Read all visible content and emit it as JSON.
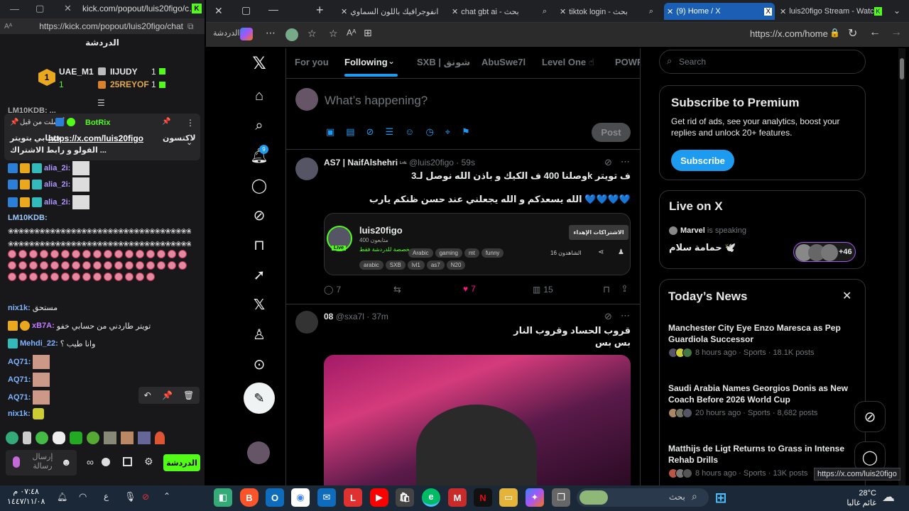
{
  "colors": {
    "kick_green": "#53fc18",
    "x_blue": "#1d9bf0",
    "accent_pink": "#f91880"
  },
  "kick_window": {
    "url_top": "kick.com/popout/luis20figo/c…",
    "url": "https://kick.com/popout/luis20figo/chat",
    "chat_title": "الدردشة",
    "leaderboard": [
      {
        "name": "UAE_M1",
        "count": "1",
        "rank": "1"
      },
      {
        "name": "IIJUDY",
        "count": "1"
      },
      {
        "name": "25REYOF",
        "count": "1"
      }
    ],
    "partial_name": "LM10KDB: ...",
    "pinned": {
      "header": "أرسلت من قبل",
      "user": "BotRix",
      "text1": "لاكتسون",
      "link": "https://x.com/luis20figo",
      "text2": "حسابي بتويتر",
      "text3": "الفولو و رابط الاشتراك ..."
    },
    "messages": [
      {
        "user": "alia_2i:",
        "type": "img"
      },
      {
        "user": "alia_2i:",
        "type": "img"
      },
      {
        "user": "alia_2i:",
        "type": "img"
      },
      {
        "user": "LM10KDB:",
        "type": "text",
        "text": ""
      },
      {
        "user": "nix1k:",
        "type": "text",
        "text": "مستحق"
      },
      {
        "user": "xB7A:",
        "type": "text",
        "text": "تويتر طاردني من حسابي خفو"
      },
      {
        "user": "Mehdi_22:",
        "type": "text",
        "text": "وانا طيب ؟"
      },
      {
        "user": "AQ71:",
        "type": "img"
      },
      {
        "user": "AQ71:",
        "type": "img"
      },
      {
        "user": "AQ71:",
        "type": "img"
      },
      {
        "user": "nix1k:",
        "type": "img"
      }
    ],
    "send_placeholder": "إرسال رسالة",
    "chat_button": "الدردشة"
  },
  "edge": {
    "tabs": [
      {
        "label": "انفوجرافيك باللون السماوي"
      },
      {
        "label": "chat gbt ai - بحث"
      },
      {
        "label": "tiktok login - بحث"
      },
      {
        "label": "(9) Home / X"
      },
      {
        "label": "luis20figo Stream - Watc"
      }
    ],
    "address": "https://x.com/home",
    "sidebar_label": "الدردشة",
    "status_url": "https://x.com/luis20figo"
  },
  "x": {
    "notif_badge": "9",
    "feed_tabs": [
      "For you",
      "Following",
      "SXB | شونق",
      "AbuSwe7l",
      "Level One ☝",
      "POWR"
    ],
    "compose_placeholder": "What’s happening?",
    "post_button": "Post",
    "posts": [
      {
        "name": "AS7 | NaifAlshehri",
        "badge": "ᴸᵛˡ¹",
        "handle": "@luis20figo",
        "time": "59s",
        "line1": "وصلنا 400 ف الكيك و باذن الله نوصل لـ3k ف تويتر",
        "line2": "الله يسعدكم و الله يجعلني عند حسن ظنكم يارب 💙💙💙💙",
        "embed": {
          "title": "luis20figo",
          "followers": "400 متابعون",
          "live": "Live",
          "sub_label": "مخصصة للدردشة فقط",
          "tags": [
            "Arabic",
            "gaming",
            "mt",
            "funny",
            "arabic",
            "SXB",
            "lvl1",
            "as7",
            "N20"
          ],
          "sub_button": "الاشتراكات الإهداء",
          "viewers": "الشاهدون 16"
        },
        "stats": {
          "replies": "7",
          "reposts": "",
          "likes": "7",
          "views": "15"
        }
      },
      {
        "name": "08",
        "handle": "@sxa7l",
        "time": "37m",
        "line1": "قروب الحساد وقروب النار",
        "line2": "بس بس"
      }
    ],
    "search_placeholder": "Search",
    "premium": {
      "title": "Subscribe to Premium",
      "desc": "Get rid of ads, see your analytics, boost your replies and unlock 20+ features.",
      "button": "Subscribe"
    },
    "live": {
      "title": "Live on X",
      "host": "Marvel",
      "speaking": "is speaking",
      "space": "حمامة سلام 🕊️",
      "count": "+46"
    },
    "news": {
      "title": "Today’s News",
      "items": [
        {
          "headline": "Manchester City Eye Enzo Maresca as Pep Guardiola Successor",
          "meta": "8 hours ago · Sports · 18.1K posts"
        },
        {
          "headline": "Saudi Arabia Names Georgios Donis as New Coach Before 2026 World Cup",
          "meta": "20 hours ago · Sports · 8,682 posts"
        },
        {
          "headline": "Matthijs de Ligt Returns to Grass in Intense Rehab Drills",
          "meta": "8 hours ago · Sports · 13K posts"
        }
      ]
    }
  },
  "taskbar": {
    "time": "٠٧:٤٨ م",
    "date": "١٤٤٧/١١/٠٨",
    "lang": "ع",
    "search": "بحث",
    "temp": "28°C",
    "weather": "غائم غالبا"
  }
}
